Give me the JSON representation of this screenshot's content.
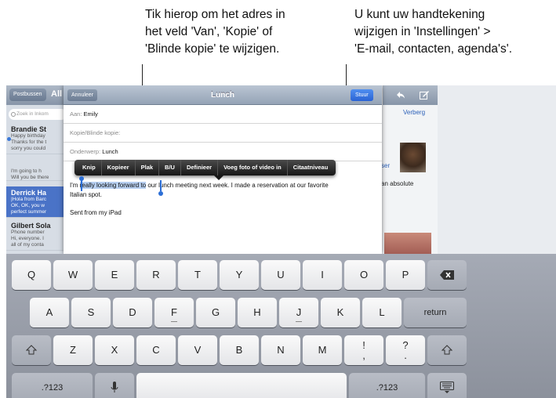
{
  "callouts": {
    "left": [
      "Tik hierop om het adres in",
      "het veld 'Van', 'Kopie' of",
      "'Blinde kopie' te wijzigen."
    ],
    "right": [
      "U kunt uw handtekening",
      "wijzigen in 'Instellingen' >",
      "'E-mail, contacten, agenda's'."
    ]
  },
  "maillist": {
    "back_button": "Postbussen",
    "title": "All",
    "search_placeholder": "Zoek in Inkom",
    "items": [
      {
        "sender": "Brandie St",
        "lines": [
          "Happy birthday",
          "Thanks for the t",
          "sorry you could"
        ]
      },
      {
        "sender": "",
        "lines": [
          "I'm going to h",
          "Will you be there"
        ]
      },
      {
        "sender": "Derrick Ha",
        "lines": [
          "|Hola from Barc",
          "OK, OK, you w",
          "perfect summer"
        ]
      },
      {
        "sender": "Gilbert Sola",
        "lines": [
          "Phone number",
          "Hi, everyone. I",
          "all of my conta"
        ]
      }
    ]
  },
  "message_pane": {
    "hide_link": "Verberg",
    "partial_link": "ser",
    "partial_text": "an absolute"
  },
  "compose": {
    "cancel_button": "Annuleer",
    "title": "Lunch",
    "send_button": "Stuur",
    "to_label": "Aan:",
    "to_value": "Emily",
    "cc_label": "Kopie/Blinde kopie:",
    "subject_label": "Onderwerp:",
    "subject_value": "Lunch",
    "body_before": "I'm ",
    "body_selected": "really looking forward to",
    "body_after": " our lunch meeting next week. I made a reservation at our favorite",
    "body_line2": "Italian spot.",
    "signature": "Sent from my iPad"
  },
  "edit_menu": [
    "Knip",
    "Kopieer",
    "Plak",
    "B/U",
    "Definieer",
    "Voeg foto of video in",
    "Citaatniveau"
  ],
  "keyboard": {
    "row1": [
      "Q",
      "W",
      "E",
      "R",
      "T",
      "Y",
      "U",
      "I",
      "O",
      "P"
    ],
    "row2": [
      "A",
      "S",
      "D",
      "F",
      "G",
      "H",
      "J",
      "K",
      "L"
    ],
    "row3": [
      "Z",
      "X",
      "C",
      "V",
      "B",
      "N",
      "M"
    ],
    "return_label": "return",
    "numbers_label": ".?123",
    "punct1_top": "!",
    "punct1_bottom": ",",
    "punct2_top": "?",
    "punct2_bottom": "."
  }
}
